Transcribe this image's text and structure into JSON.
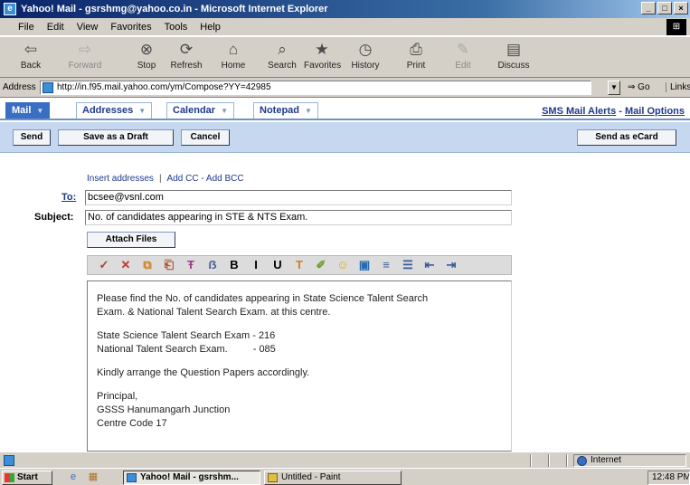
{
  "window": {
    "title": "Yahoo! Mail - gsrshmg@yahoo.co.in - Microsoft Internet Explorer",
    "controls": [
      "_",
      "□",
      "×"
    ]
  },
  "menu": [
    "File",
    "Edit",
    "View",
    "Favorites",
    "Tools",
    "Help"
  ],
  "toolbar": [
    {
      "label": "Back",
      "icon": "back-arrow-icon",
      "glyph": "⇦",
      "enabled": true
    },
    {
      "label": "Forward",
      "icon": "forward-arrow-icon",
      "glyph": "⇨",
      "enabled": false
    },
    {
      "label": "Stop",
      "icon": "stop-icon",
      "glyph": "⊗",
      "enabled": true
    },
    {
      "label": "Refresh",
      "icon": "refresh-icon",
      "glyph": "⟳",
      "enabled": true
    },
    {
      "label": "Home",
      "icon": "home-icon",
      "glyph": "⌂",
      "enabled": true
    },
    {
      "label": "Search",
      "icon": "search-icon",
      "glyph": "⌕",
      "enabled": true
    },
    {
      "label": "Favorites",
      "icon": "favorites-icon",
      "glyph": "★",
      "enabled": true
    },
    {
      "label": "History",
      "icon": "history-icon",
      "glyph": "◷",
      "enabled": true
    },
    {
      "label": "Print",
      "icon": "print-icon",
      "glyph": "⎙",
      "enabled": true
    },
    {
      "label": "Edit",
      "icon": "edit-icon",
      "glyph": "✎",
      "enabled": false
    },
    {
      "label": "Discuss",
      "icon": "discuss-icon",
      "glyph": "▤",
      "enabled": true
    }
  ],
  "address": {
    "label": "Address",
    "url": "http://in.f95.mail.yahoo.com/ym/Compose?YY=42985",
    "go_label": "Go",
    "links_label": "Links"
  },
  "yahoo_nav": {
    "tabs": [
      {
        "label": "Mail",
        "active": true
      },
      {
        "label": "Addresses",
        "active": false
      },
      {
        "label": "Calendar",
        "active": false
      },
      {
        "label": "Notepad",
        "active": false
      }
    ],
    "links": [
      "SMS Mail Alerts",
      "Mail Options"
    ],
    "link_separator": " - "
  },
  "actions": {
    "send": "Send",
    "save_draft": "Save as a Draft",
    "cancel": "Cancel",
    "send_ecard": "Send as eCard"
  },
  "compose": {
    "insert_addresses": "Insert addresses",
    "add_cc_bcc": "Add CC - Add BCC",
    "separator": "|",
    "to_label": "To:",
    "to_value": "bcsee@vsnl.com",
    "subject_label": "Subject:",
    "subject_value": "No. of candidates appearing in STE & NTS Exam.",
    "attach_files": "Attach Files"
  },
  "format_toolbar": [
    {
      "icon": "spellcheck-icon",
      "glyph": "✓",
      "color": "#b0402e"
    },
    {
      "icon": "cut-icon",
      "glyph": "✕",
      "color": "#c0392b"
    },
    {
      "icon": "copy-icon",
      "glyph": "⧉",
      "color": "#d08020"
    },
    {
      "icon": "paste-icon",
      "glyph": "⎗",
      "color": "#b04a2a"
    },
    {
      "icon": "font-icon",
      "glyph": "Ŧ",
      "color": "#a03a8a"
    },
    {
      "icon": "font-size-icon",
      "glyph": "ẞ",
      "color": "#5060a0"
    },
    {
      "icon": "bold-icon",
      "glyph": "B",
      "color": "#000000"
    },
    {
      "icon": "italic-icon",
      "glyph": "I",
      "color": "#000000"
    },
    {
      "icon": "underline-icon",
      "glyph": "U",
      "color": "#000000"
    },
    {
      "icon": "text-color-icon",
      "glyph": "T",
      "color": "#d08020"
    },
    {
      "icon": "highlight-icon",
      "glyph": "✐",
      "color": "#6aa02a"
    },
    {
      "icon": "smiley-icon",
      "glyph": "☺",
      "color": "#e0b000"
    },
    {
      "icon": "image-icon",
      "glyph": "▣",
      "color": "#2a6ab0"
    },
    {
      "icon": "align-icon",
      "glyph": "≡",
      "color": "#3a5a9a"
    },
    {
      "icon": "numbered-list-icon",
      "glyph": "☰",
      "color": "#3a5a9a"
    },
    {
      "icon": "outdent-icon",
      "glyph": "⇤",
      "color": "#3a5a9a"
    },
    {
      "icon": "indent-icon",
      "glyph": "⇥",
      "color": "#3a5a9a"
    }
  ],
  "message": {
    "line1": "Please find the No. of candidates appearing in State Science Talent Search",
    "line2": "Exam. & National Talent Search Exam. at this centre.",
    "line3a": "State Science Talent Search Exam - 216",
    "line3b_label": "National Talent Search Exam.",
    "line3b_value": "- 085",
    "line4": "Kindly arrange the Question Papers accordingly.",
    "sig1": "Principal,",
    "sig2": "GSSS Hanumangarh Junction",
    "sig3": "Centre Code 17"
  },
  "statusbar": {
    "zone": "Internet"
  },
  "taskbar": {
    "start": "Start",
    "tasks": [
      {
        "label": "Yahoo! Mail - gsrshm...",
        "active": true
      },
      {
        "label": "Untitled - Paint",
        "active": false
      }
    ],
    "clock": "12:48 PM"
  },
  "colors": {
    "titlebar": "#0a246a",
    "yahoo_accent": "#3a6ec2",
    "link": "#1e3a8a",
    "action_bar": "#c6d8ef"
  }
}
